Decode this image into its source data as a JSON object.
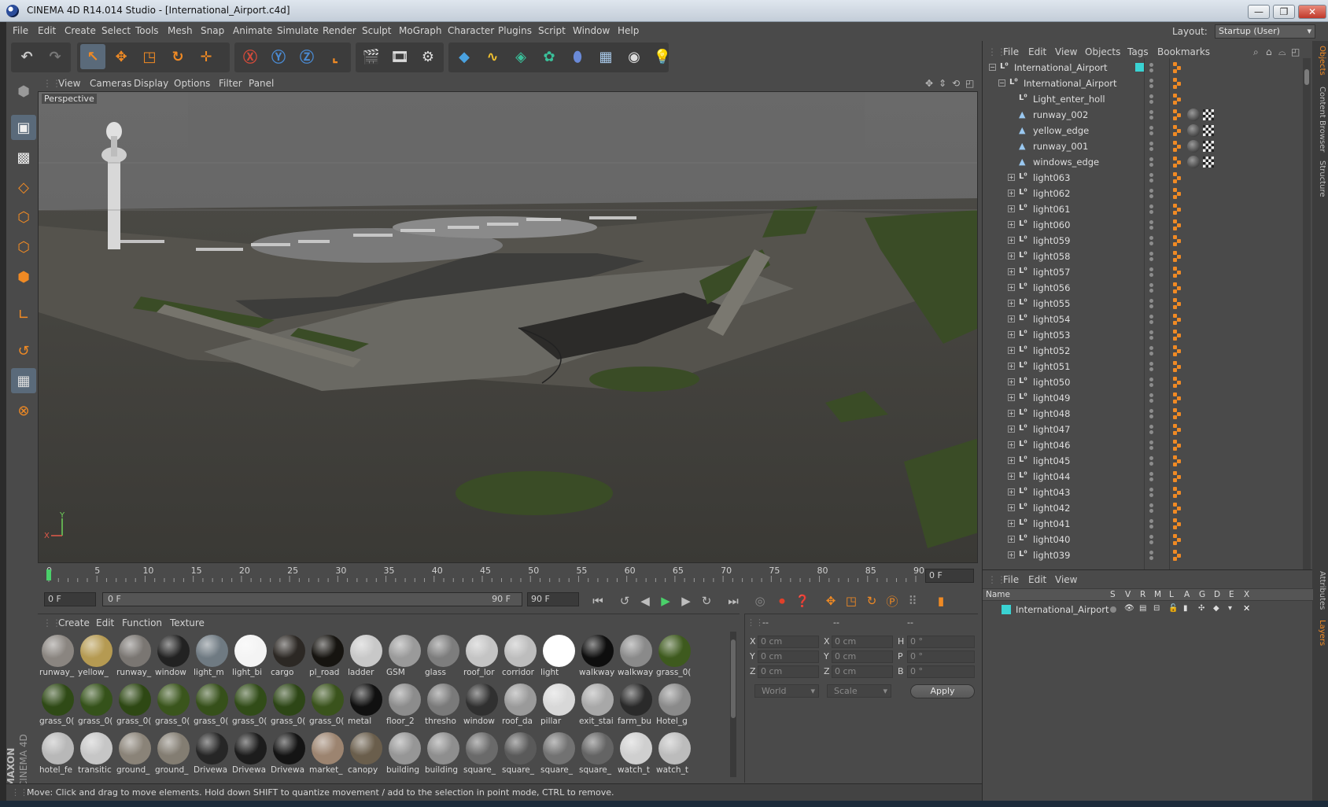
{
  "window": {
    "title": "CINEMA 4D R14.014 Studio - [International_Airport.c4d]",
    "controls": [
      "—",
      "❐",
      "✕"
    ]
  },
  "menubar": {
    "items": [
      "File",
      "Edit",
      "Create",
      "Select",
      "Tools",
      "Mesh",
      "Snap",
      "Animate",
      "Simulate",
      "Render",
      "Sculpt",
      "MoGraph",
      "Character",
      "Plugins",
      "Script",
      "Window",
      "Help"
    ],
    "layout_label": "Layout:",
    "layout_value": "Startup (User)"
  },
  "viewport": {
    "menu": [
      "View",
      "Cameras",
      "Display",
      "Options",
      "Filter",
      "Panel"
    ],
    "camera_label": "Perspective",
    "axis": {
      "x": "X",
      "y": "Y"
    }
  },
  "timeline": {
    "ticks": [
      "0",
      "5",
      "10",
      "15",
      "20",
      "25",
      "30",
      "35",
      "40",
      "45",
      "50",
      "55",
      "60",
      "65",
      "70",
      "75",
      "80",
      "85",
      "90"
    ],
    "current_frame": "0 F",
    "start_frame": "0 F",
    "range_start": "0 F",
    "range_end": "90 F",
    "end_frame": "90 F"
  },
  "materials": {
    "menu": [
      "Create",
      "Edit",
      "Function",
      "Texture"
    ],
    "items": [
      {
        "name": "runway_",
        "color": "#8a8580"
      },
      {
        "name": "yellow_",
        "color": "#b59a52"
      },
      {
        "name": "runway_",
        "color": "#7a7672"
      },
      {
        "name": "window",
        "color": "#222222"
      },
      {
        "name": "light_m",
        "color": "#6f7a82"
      },
      {
        "name": "light_bi",
        "color": "#f4f4f4"
      },
      {
        "name": "cargo",
        "color": "#2c2824"
      },
      {
        "name": "pl_road",
        "color": "#161410"
      },
      {
        "name": "ladder",
        "color": "#c8c8c8"
      },
      {
        "name": "GSM",
        "color": "#9a9a9a"
      },
      {
        "name": "glass",
        "color": "#7d7d7d"
      },
      {
        "name": "roof_lor",
        "color": "#c4c4c4"
      },
      {
        "name": "corridor",
        "color": "#bdbdbd"
      },
      {
        "name": "light",
        "color": "#ffffff"
      },
      {
        "name": "walkway",
        "color": "#0e0e0e"
      },
      {
        "name": "walkway",
        "color": "#8a8a8a"
      },
      {
        "name": "grass_0(",
        "color": "#3e5a1e"
      },
      {
        "name": "grass_0(",
        "color": "#2f4a16"
      },
      {
        "name": "grass_0(",
        "color": "#35521a"
      },
      {
        "name": "grass_0(",
        "color": "#2e4814"
      },
      {
        "name": "grass_0(",
        "color": "#3a551c"
      },
      {
        "name": "grass_0(",
        "color": "#36501a"
      },
      {
        "name": "grass_0(",
        "color": "#314c18"
      },
      {
        "name": "grass_0(",
        "color": "#2d4616"
      },
      {
        "name": "grass_0(",
        "color": "#3a531c"
      },
      {
        "name": "metal",
        "color": "#101010"
      },
      {
        "name": "floor_2",
        "color": "#8c8c8c"
      },
      {
        "name": "thresho",
        "color": "#7a7a7a"
      },
      {
        "name": "window",
        "color": "#303030"
      },
      {
        "name": "roof_da",
        "color": "#9a9a9a"
      },
      {
        "name": "pillar",
        "color": "#d8d8d8"
      },
      {
        "name": "exit_stai",
        "color": "#a8a8a8"
      },
      {
        "name": "farm_bu",
        "color": "#2a2a2a"
      },
      {
        "name": "Hotel_g",
        "color": "#8a8a8a"
      },
      {
        "name": "hotel_fe",
        "color": "#b8b8b8"
      },
      {
        "name": "transitic",
        "color": "#c6c6c6"
      },
      {
        "name": "ground_",
        "color": "#8a8378"
      },
      {
        "name": "ground_",
        "color": "#837d72"
      },
      {
        "name": "Drivewa",
        "color": "#262626"
      },
      {
        "name": "Drivewa",
        "color": "#1c1c1c"
      },
      {
        "name": "Drivewa",
        "color": "#141414"
      },
      {
        "name": "market_",
        "color": "#9c8470"
      },
      {
        "name": "canopy",
        "color": "#6a5e4c"
      },
      {
        "name": "building",
        "color": "#969696"
      },
      {
        "name": "building",
        "color": "#8e8e8e"
      },
      {
        "name": "square_",
        "color": "#6a6a6a"
      },
      {
        "name": "square_",
        "color": "#5a5a5a"
      },
      {
        "name": "square_",
        "color": "#727272"
      },
      {
        "name": "square_",
        "color": "#646464"
      },
      {
        "name": "watch_t",
        "color": "#cfcfcf"
      },
      {
        "name": "watch_t",
        "color": "#bcbcbc"
      }
    ]
  },
  "coordinates": {
    "headers": [
      "--",
      "--",
      "--"
    ],
    "rows": [
      {
        "a": "X",
        "av": "0 cm",
        "b": "X",
        "bv": "0 cm",
        "c": "H",
        "cv": "0 °"
      },
      {
        "a": "Y",
        "av": "0 cm",
        "b": "Y",
        "bv": "0 cm",
        "c": "P",
        "cv": "0 °"
      },
      {
        "a": "Z",
        "av": "0 cm",
        "b": "Z",
        "bv": "0 cm",
        "c": "B",
        "cv": "0 °"
      }
    ],
    "mode": "World",
    "type": "Scale",
    "apply": "Apply"
  },
  "object_manager": {
    "menu": [
      "File",
      "Edit",
      "View",
      "Objects",
      "Tags",
      "Bookmarks"
    ],
    "rows": [
      {
        "name": "International_Airport",
        "indent": 0,
        "kind": "null",
        "expand": "−"
      },
      {
        "name": "International_Airport",
        "indent": 1,
        "kind": "null",
        "expand": "−"
      },
      {
        "name": "Light_enter_holl",
        "indent": 2,
        "kind": "null",
        "expand": ""
      },
      {
        "name": "runway_002",
        "indent": 2,
        "kind": "poly",
        "expand": ""
      },
      {
        "name": "yellow_edge",
        "indent": 2,
        "kind": "poly",
        "expand": ""
      },
      {
        "name": "runway_001",
        "indent": 2,
        "kind": "poly",
        "expand": ""
      },
      {
        "name": "windows_edge",
        "indent": 2,
        "kind": "poly",
        "expand": ""
      },
      {
        "name": "light063",
        "indent": 2,
        "kind": "null",
        "expand": "+"
      },
      {
        "name": "light062",
        "indent": 2,
        "kind": "null",
        "expand": "+"
      },
      {
        "name": "light061",
        "indent": 2,
        "kind": "null",
        "expand": "+"
      },
      {
        "name": "light060",
        "indent": 2,
        "kind": "null",
        "expand": "+"
      },
      {
        "name": "light059",
        "indent": 2,
        "kind": "null",
        "expand": "+"
      },
      {
        "name": "light058",
        "indent": 2,
        "kind": "null",
        "expand": "+"
      },
      {
        "name": "light057",
        "indent": 2,
        "kind": "null",
        "expand": "+"
      },
      {
        "name": "light056",
        "indent": 2,
        "kind": "null",
        "expand": "+"
      },
      {
        "name": "light055",
        "indent": 2,
        "kind": "null",
        "expand": "+"
      },
      {
        "name": "light054",
        "indent": 2,
        "kind": "null",
        "expand": "+"
      },
      {
        "name": "light053",
        "indent": 2,
        "kind": "null",
        "expand": "+"
      },
      {
        "name": "light052",
        "indent": 2,
        "kind": "null",
        "expand": "+"
      },
      {
        "name": "light051",
        "indent": 2,
        "kind": "null",
        "expand": "+"
      },
      {
        "name": "light050",
        "indent": 2,
        "kind": "null",
        "expand": "+"
      },
      {
        "name": "light049",
        "indent": 2,
        "kind": "null",
        "expand": "+"
      },
      {
        "name": "light048",
        "indent": 2,
        "kind": "null",
        "expand": "+"
      },
      {
        "name": "light047",
        "indent": 2,
        "kind": "null",
        "expand": "+"
      },
      {
        "name": "light046",
        "indent": 2,
        "kind": "null",
        "expand": "+"
      },
      {
        "name": "light045",
        "indent": 2,
        "kind": "null",
        "expand": "+"
      },
      {
        "name": "light044",
        "indent": 2,
        "kind": "null",
        "expand": "+"
      },
      {
        "name": "light043",
        "indent": 2,
        "kind": "null",
        "expand": "+"
      },
      {
        "name": "light042",
        "indent": 2,
        "kind": "null",
        "expand": "+"
      },
      {
        "name": "light041",
        "indent": 2,
        "kind": "null",
        "expand": "+"
      },
      {
        "name": "light040",
        "indent": 2,
        "kind": "null",
        "expand": "+"
      },
      {
        "name": "light039",
        "indent": 2,
        "kind": "null",
        "expand": "+"
      }
    ]
  },
  "side_tabs": [
    "Objects",
    "Content Browser",
    "Structure",
    "Attributes",
    "Layers"
  ],
  "layer_manager": {
    "menu": [
      "File",
      "Edit",
      "View"
    ],
    "columns": [
      "Name",
      "S",
      "V",
      "R",
      "M",
      "L",
      "A",
      "G",
      "D",
      "E",
      "X"
    ],
    "layers": [
      {
        "name": "International_Airport",
        "color": "#3ad3d3"
      }
    ]
  },
  "status": {
    "text": "Move: Click and drag to move elements. Hold down SHIFT to quantize movement / add to the selection in point mode, CTRL to remove."
  },
  "brand": {
    "line1": "MAXON",
    "line2": "CINEMA 4D"
  },
  "colors": {
    "accent": "#f08a24",
    "selection": "#3a80c8",
    "layer_cyan": "#3ad3d3"
  }
}
